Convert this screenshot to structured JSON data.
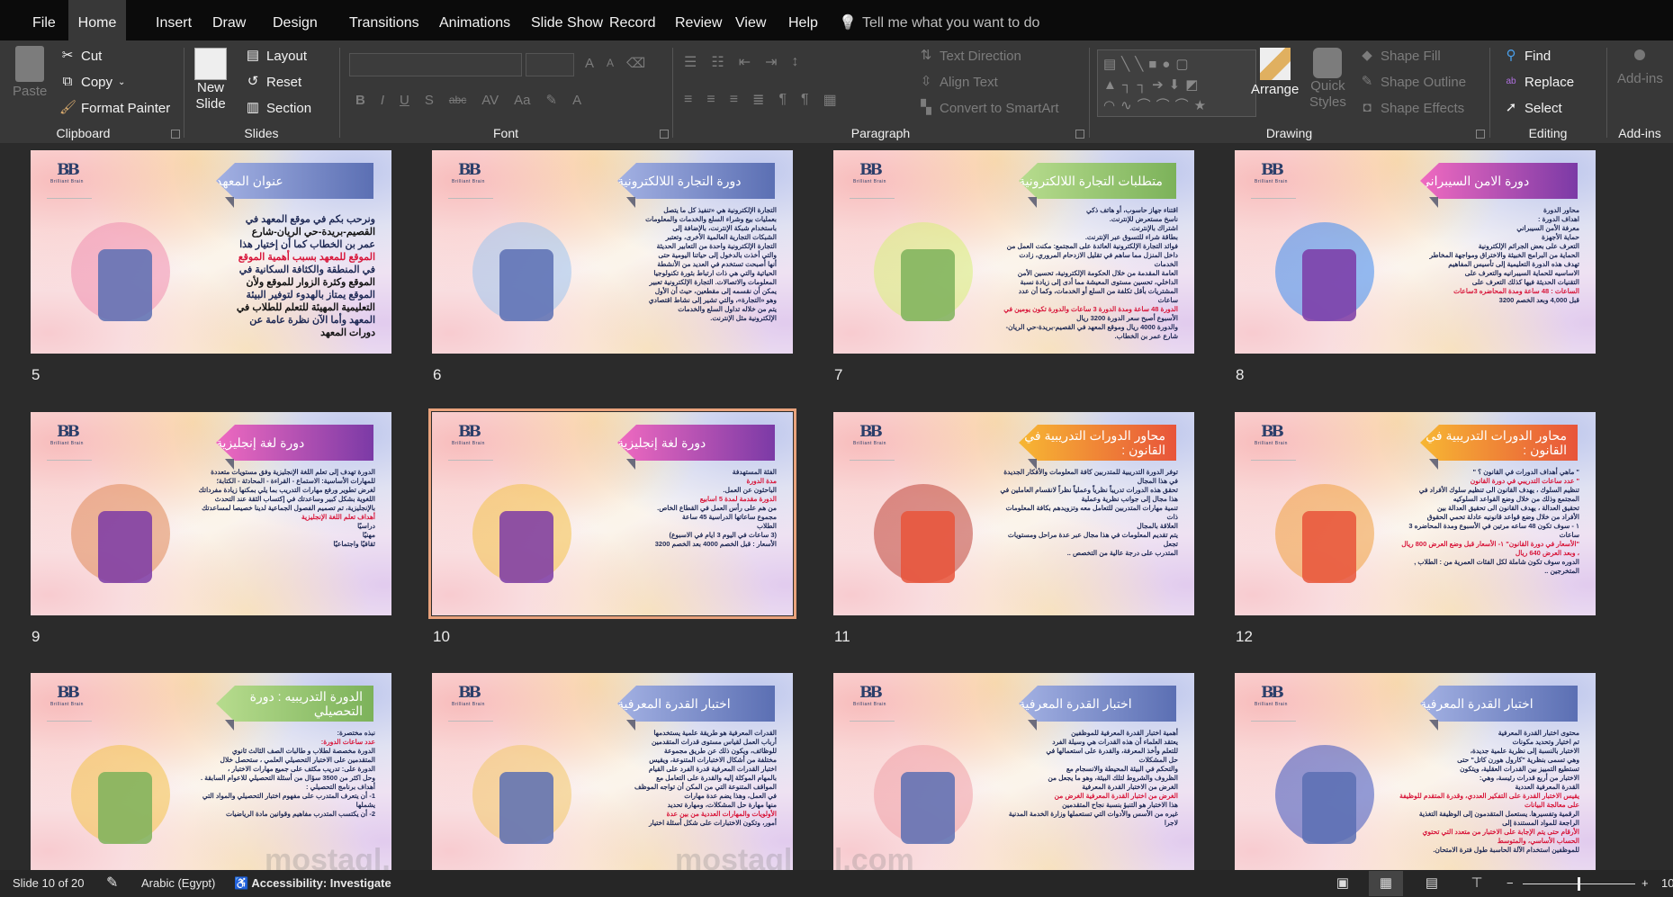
{
  "tabs": [
    "File",
    "Home",
    "Insert",
    "Draw",
    "Design",
    "Transitions",
    "Animations",
    "Slide Show",
    "Record",
    "Review",
    "View",
    "Help"
  ],
  "active_tab": "Home",
  "tell_me": "Tell me what you want to do",
  "ribbon": {
    "clipboard": {
      "paste": "Paste",
      "cut": "Cut",
      "copy": "Copy",
      "format_painter": "Format Painter",
      "label": "Clipboard"
    },
    "slides": {
      "new_slide_1": "New",
      "new_slide_2": "Slide",
      "layout": "Layout",
      "reset": "Reset",
      "section": "Section",
      "label": "Slides"
    },
    "font": {
      "label": "Font",
      "bold": "B",
      "italic": "I",
      "underline": "U",
      "shadow": "S",
      "strike": "abc",
      "spacing": "AV",
      "case": "Aa",
      "grow": "A",
      "shrink": "A",
      "color": "A"
    },
    "paragraph": {
      "label": "Paragraph",
      "text_direction": "Text Direction",
      "align_text": "Align Text",
      "smartart": "Convert to SmartArt"
    },
    "drawing": {
      "label": "Drawing",
      "arrange": "Arrange",
      "quick_styles_1": "Quick",
      "quick_styles_2": "Styles",
      "shape_fill": "Shape Fill",
      "shape_outline": "Shape Outline",
      "shape_effects": "Shape Effects"
    },
    "editing": {
      "label": "Editing",
      "find": "Find",
      "replace": "Replace",
      "select": "Select"
    },
    "addins": {
      "label": "Add-ins",
      "button": "Add-ins"
    }
  },
  "logo": {
    "mark": "BB",
    "name": "Brilliant Brain"
  },
  "watermark": "mostaql.com",
  "selected_slide": 10,
  "slides": [
    {
      "num": "5",
      "title": "عنوان المعهد",
      "colors": [
        "#a3b1e3",
        "#5b6fb3"
      ],
      "art": "#f08fb0",
      "big": true,
      "lines": [
        "ونرحب بكم في موقع المعهد في",
        "القصيم-بريدة-حي الريان-شارع",
        "عمر بن الخطاب كما أن إختيار هذا",
        "الموقع للمعهد بسبب أهمية الموقع",
        "في المنطقة والكثافة السكانية في",
        "الموقع وكثرة الزوار للموقع ولأن",
        "الموقع يمتاز بالهدوء لتوفير البيئة",
        "التعليمية المهيئة للتعلم للطلاب في",
        "المعهد وأما الآن نظرة عامة عن",
        "دورات المعهد"
      ]
    },
    {
      "num": "6",
      "title": "دورة التجارة اللالكترونية",
      "colors": [
        "#a3b1e3",
        "#5b6fb3"
      ],
      "art": "#9fc4ef",
      "lines": [
        "التجارة الإلكترونية هي «تنفيذ كل ما يتصل",
        "بعمليات بيع وشراء السلع والخدمات والمعلومات",
        "باستخدام شبكة الإنترنت، بالإضافة إلى",
        "الشبكات التجارية العالمية الأخرى، وتعتبر",
        "التجارة الإلكترونية واحدة من التعابير الحديثة",
        "والتي أخذت بالدخول إلى حياتنا اليومية حتى",
        "أنها أصبحت تستخدم في العديد من الأنشطة",
        "الحياتية والتي هي ذات ارتباط بثورة تكنولوجيا",
        "المعلومات والاتصالات. التجارة الإلكترونية تعبير",
        "يمكن أن نقسمه إلى مقطعين، حيث أن الأول",
        "وهو «التجارة»، والتي تشير إلى نشاط اقتصادي",
        "يتم من خلاله تداول السلع والخدمات",
        "الإلكترونية مثل الإنترنت."
      ]
    },
    {
      "num": "7",
      "title": "متطلبات التجارة اللالكترونية",
      "colors": [
        "#b7dc8e",
        "#7cb25a"
      ],
      "art": "#d7f07a",
      "lines": [
        "اقتناء جهاز حاسوب، أو هاتف ذكي",
        "ناسخ مستعرض للإنترنت.",
        "اشتراك بالإنترنت.",
        "بطاقة شراء للتسوق عبر الإنترنت.",
        "فوائد التجارة الإلكترونية العائدة على المجتمع: مكنت العمل من",
        "داخل المنزل مما ساهم في تقليل الازدحام المروري، زادت الخدمات",
        "العامة المقدمة من خلال الحكومة الإلكترونية، تحسين الأمن",
        "الداخلي، تحسين مستوى المعيشة مما أدى إلى زيادة نسبة",
        "المشتريات بأقل تكلفة من السلع أو الخدمات، وكما أن عدد ساعات",
        "الدورة 48 ساعة ومدة الدورة 3 ساعات والدورة تكون يومين في",
        "الأسبوع أصبح سعر الدورة 3200 ريال",
        "والدورة 4000 ريال وموقع المعهد في القصيم-بريدة-حي الريان-شارع عمر بن الخطاب."
      ]
    },
    {
      "num": "8",
      "title": "دورة الامن السيبراني",
      "colors": [
        "#f06ac0",
        "#7b3aa6"
      ],
      "art": "#3e8cf0",
      "lines": [
        "محاور الدورة",
        "اهداف الدورة :",
        "معرفة الأمن السيبراني",
        "حماية الأجهزة",
        "التعرف على بعض الجرائم الإلكترونية",
        "الحماية من البرامج الخبيثة والاختراق ومواجهة المخاطر",
        "تهدف هذه الدورة التعليمية إلى تأسيس المفاهيم",
        "الاساسيه للحماية السيبرانيه والتعرف على",
        "التقنيات الحديثة فيها كذلك التعرف على",
        "الساعات : 48 ساعة ومدة المحاضره 3ساعات",
        "قبل 4,000 وبعد الخصم 3200"
      ]
    },
    {
      "num": "9",
      "title": "دورة لغة إنجليزية",
      "colors": [
        "#f06ac0",
        "#7b3aa6"
      ],
      "art": "#e08a5a",
      "lines": [
        "الدورة تهدف إلى تعلم اللغة الإنجليزية وفق مستويات متعددة",
        "للمهارات الأساسية: الاستماع - القراءة - المحادثة - الكتابة؛",
        "لغرض تطوير ورفع مهارات التدريب بما يلي بمكنها زيادة مفرداتك",
        "اللغوية بشكل كبير وساعدتك في إكتساب الثقة عند التحدث",
        "بالإنجليزية، تم تصميم الفصول الجماعية لدينا خصيصا لمساعدتك",
        "أهداف تعلم اللغة الإنجليزية",
        "دراسيًا",
        "مهنيًا",
        "ثقافيًا واجتماعيًا"
      ]
    },
    {
      "num": "10",
      "title": "دورة لغة إنجليزية",
      "colors": [
        "#f06ac0",
        "#7b3aa6"
      ],
      "art": "#f4c24a",
      "lines": [
        "الفئة المستهدفة",
        "مدة الدورة",
        "الباحثون عن العمل.",
        "الدورة مقدمة لمدة 5 اسابيع",
        "من هم على رأس العمل في القطاع الخاص.",
        "مجموع ساعاتها الدراسية 45 ساعة",
        "الطلاب",
        "(3 ساعات في اليوم 3 ايام في الاسبوع)",
        "الأسعار : قبل الخصم 4000 بعد الخصم 3200"
      ]
    },
    {
      "num": "11",
      "title": "محاور الدورات التدريبية في القانون :",
      "colors": [
        "#f7b733",
        "#e8543a"
      ],
      "art": "#c0453a",
      "lines": [
        "توفر الدورة التدريبية للمتدربين كافة المعلومات والأفكار الجديدة",
        "في هذا المجال",
        "تحقق هذه الدورات تدريباً نظرياً وعملياً نظراً لانقسام العاملين في",
        "هذا مجال إلى جوانب نظرية وعملية",
        "تنمية مهارات المتدربين للتعامل معه وتزويدهم بكافة المعلومات ذات",
        "العلاقة بالمجال",
        "يتم تقديم المعلومات في هذا مجال عبر عدة مراحل ومستويات تجعل",
        "المتدرب على درجة عالية من التخصص .."
      ]
    },
    {
      "num": "12",
      "title": "محاور الدورات التدريبية في القانون :",
      "colors": [
        "#f7b733",
        "#e8543a"
      ],
      "art": "#f0a040",
      "lines": [
        "\" ماهي أهداف الدورات في القانون ؟ \"",
        "\" عدد ساعات التدريبي في دورة القانون",
        "تنظيم السلوك ، يهدف القانون الى تنظيم سلوك الأفراد في",
        "المجتمع وذلك من خلال وضع القواعد السلوكيه",
        "تحقيق العدالة ، يهدف القانون الى تحقيق العدالة بين",
        "الأفراد من خلال وضع قواعد قانونيه عادلة تحمي الحقوق",
        "١ - سوف تكون 48 ساعه مرتين في الأسبوع ومدة المحاضره 3 ساعات",
        "\"الأسعار في دورة القانون\" ١- الأسعار قبل وضع العرض 800 ريال ، وبعد العرض 640 ريال",
        "الدوره سوف تكون شاملة لكل الفئات العمرية من : الطلاب , المتخرجين .."
      ]
    },
    {
      "num": "13",
      "title": "الدورة التدريبيه : دورة التحصيلي",
      "colors": [
        "#b7dc8e",
        "#7cb25a"
      ],
      "art": "#f4c24a",
      "lines": [
        "نبذه مختصرة:",
        "عدد ساعات الدورة:",
        "الدورة مخصصة لطلاب و طالبات الصف الثالث ثانوي",
        "المتقدمين على الاختبار التحصيلي العلمي ، ستحصل خلال",
        "الدورة على: تدريب مكثف على جميع مهارات الاختبار ،",
        "وحل اكثر من 3500 سؤال من أسئلة التحصيلي للاعوام السابقة .",
        "أهداف برنامج التحصيلي :",
        "1- أن يتعرف المتدرب على مفهوم اختبار التحصيلي والمواد التي يشملها",
        "2- أن يكتسب المتدرب مفاهيم وقوانين مادة الرياضيات"
      ]
    },
    {
      "num": "14",
      "title": "اختبار القدرة المعرفية",
      "colors": [
        "#a3b1e3",
        "#5b6fb3"
      ],
      "art": "#f2c96a",
      "lines": [
        "القدرات المعرفية هو طريقة علمية يستخدمها",
        "أرباب العمل لقياس مستوى قدرات المتقدمين",
        "للوظائف، ويكون ذلك عن طريق مجموعة",
        "مختلفة من أشكال الاختبارات المتنوعة، ويقيس",
        "اختبار القدرات المعرفية قدرة الفرد على القيام",
        "بالمهام الموكلة إليه والقدرة على التعامل مع",
        "المواقف المتنوعة التي من المكن أن تواجه الموظف",
        "في العمل، وهذا يضم عدة مهارات",
        "منها مهارة حل المشكلات، ومهارة تحديد",
        "الأولويات والمهارات العددية من بين عدة",
        "أمور، وتكون الاختبارات على شكل أسئلة اختيار"
      ]
    },
    {
      "num": "15",
      "title": "اختبار القدرة المعرفية",
      "colors": [
        "#a3b1e3",
        "#5b6fb3"
      ],
      "art": "#f0a0a8",
      "lines": [
        "أهمية اختبار القدرة المعرفية للموظفين",
        "يعتقد العلماء أن هذه القدرات هي وسيلة الفرد",
        "للتعلم وأخذ المعرفة، والقدرة على استعمالها في",
        "حل المشكلات",
        "والتحكم في البيئة المحيطة والانسجام مع",
        "الظروف والشروط لتلك البيئة، وهو ما يجعل من",
        "الغرض من الاختبار القدرة المعرفية",
        "الغرض من اختبار القدرة المعرفية الغرض من",
        "هذا الاختبار هو التنبؤ بنسبة نجاح المتقدمين",
        "غيره من الأسس والأدوات التي تستعملها وزارة الخدمة المدنية لاجرا"
      ]
    },
    {
      "num": "16",
      "title": "اختبار القدرة المعرفية",
      "colors": [
        "#a3b1e3",
        "#5b6fb3"
      ],
      "art": "#3e55c0",
      "lines": [
        "محتوى اختبار القدرة المعرفية",
        "تم اختيار وتحديد مكونات",
        "الاختبار بالنسبة إلى نظرية علمية جديدة،",
        "وهي تسمى بنظرية \"كارول هورن كاتل\" حتى",
        "تستطيع التمييز بين القدرات العقلية، ويتكون",
        "الاختبار من أربع قدرات رئيسة، وهي:",
        "القدرة المعرفية العددية",
        "يقيس الاختبار القدرة على التفكير العددي، وقدرة المتقدم للوظيفة على معالجة البيانات",
        "الرقمية وتفسيرها. يستعمل المتقدمون إلى الوظيفة التغذية الراجعة للمواد المستندة إلى",
        "الأرقام حتى يتم الإجابة على الاختبار من متعدد التي تحتوي الحساب الأساسي، والمتوسط",
        "للموظفين استخدام الآلة الحاسبة طول فترة الامتحان."
      ]
    }
  ],
  "status": {
    "slide_info": "Slide 10 of 20",
    "language": "Arabic (Egypt)",
    "accessibility": "Accessibility: Investigate",
    "zoom_tail": "10",
    "zoom_level_fraction": 0.5
  },
  "icons": {
    "lightbulb": "💡",
    "notes": "✎"
  }
}
